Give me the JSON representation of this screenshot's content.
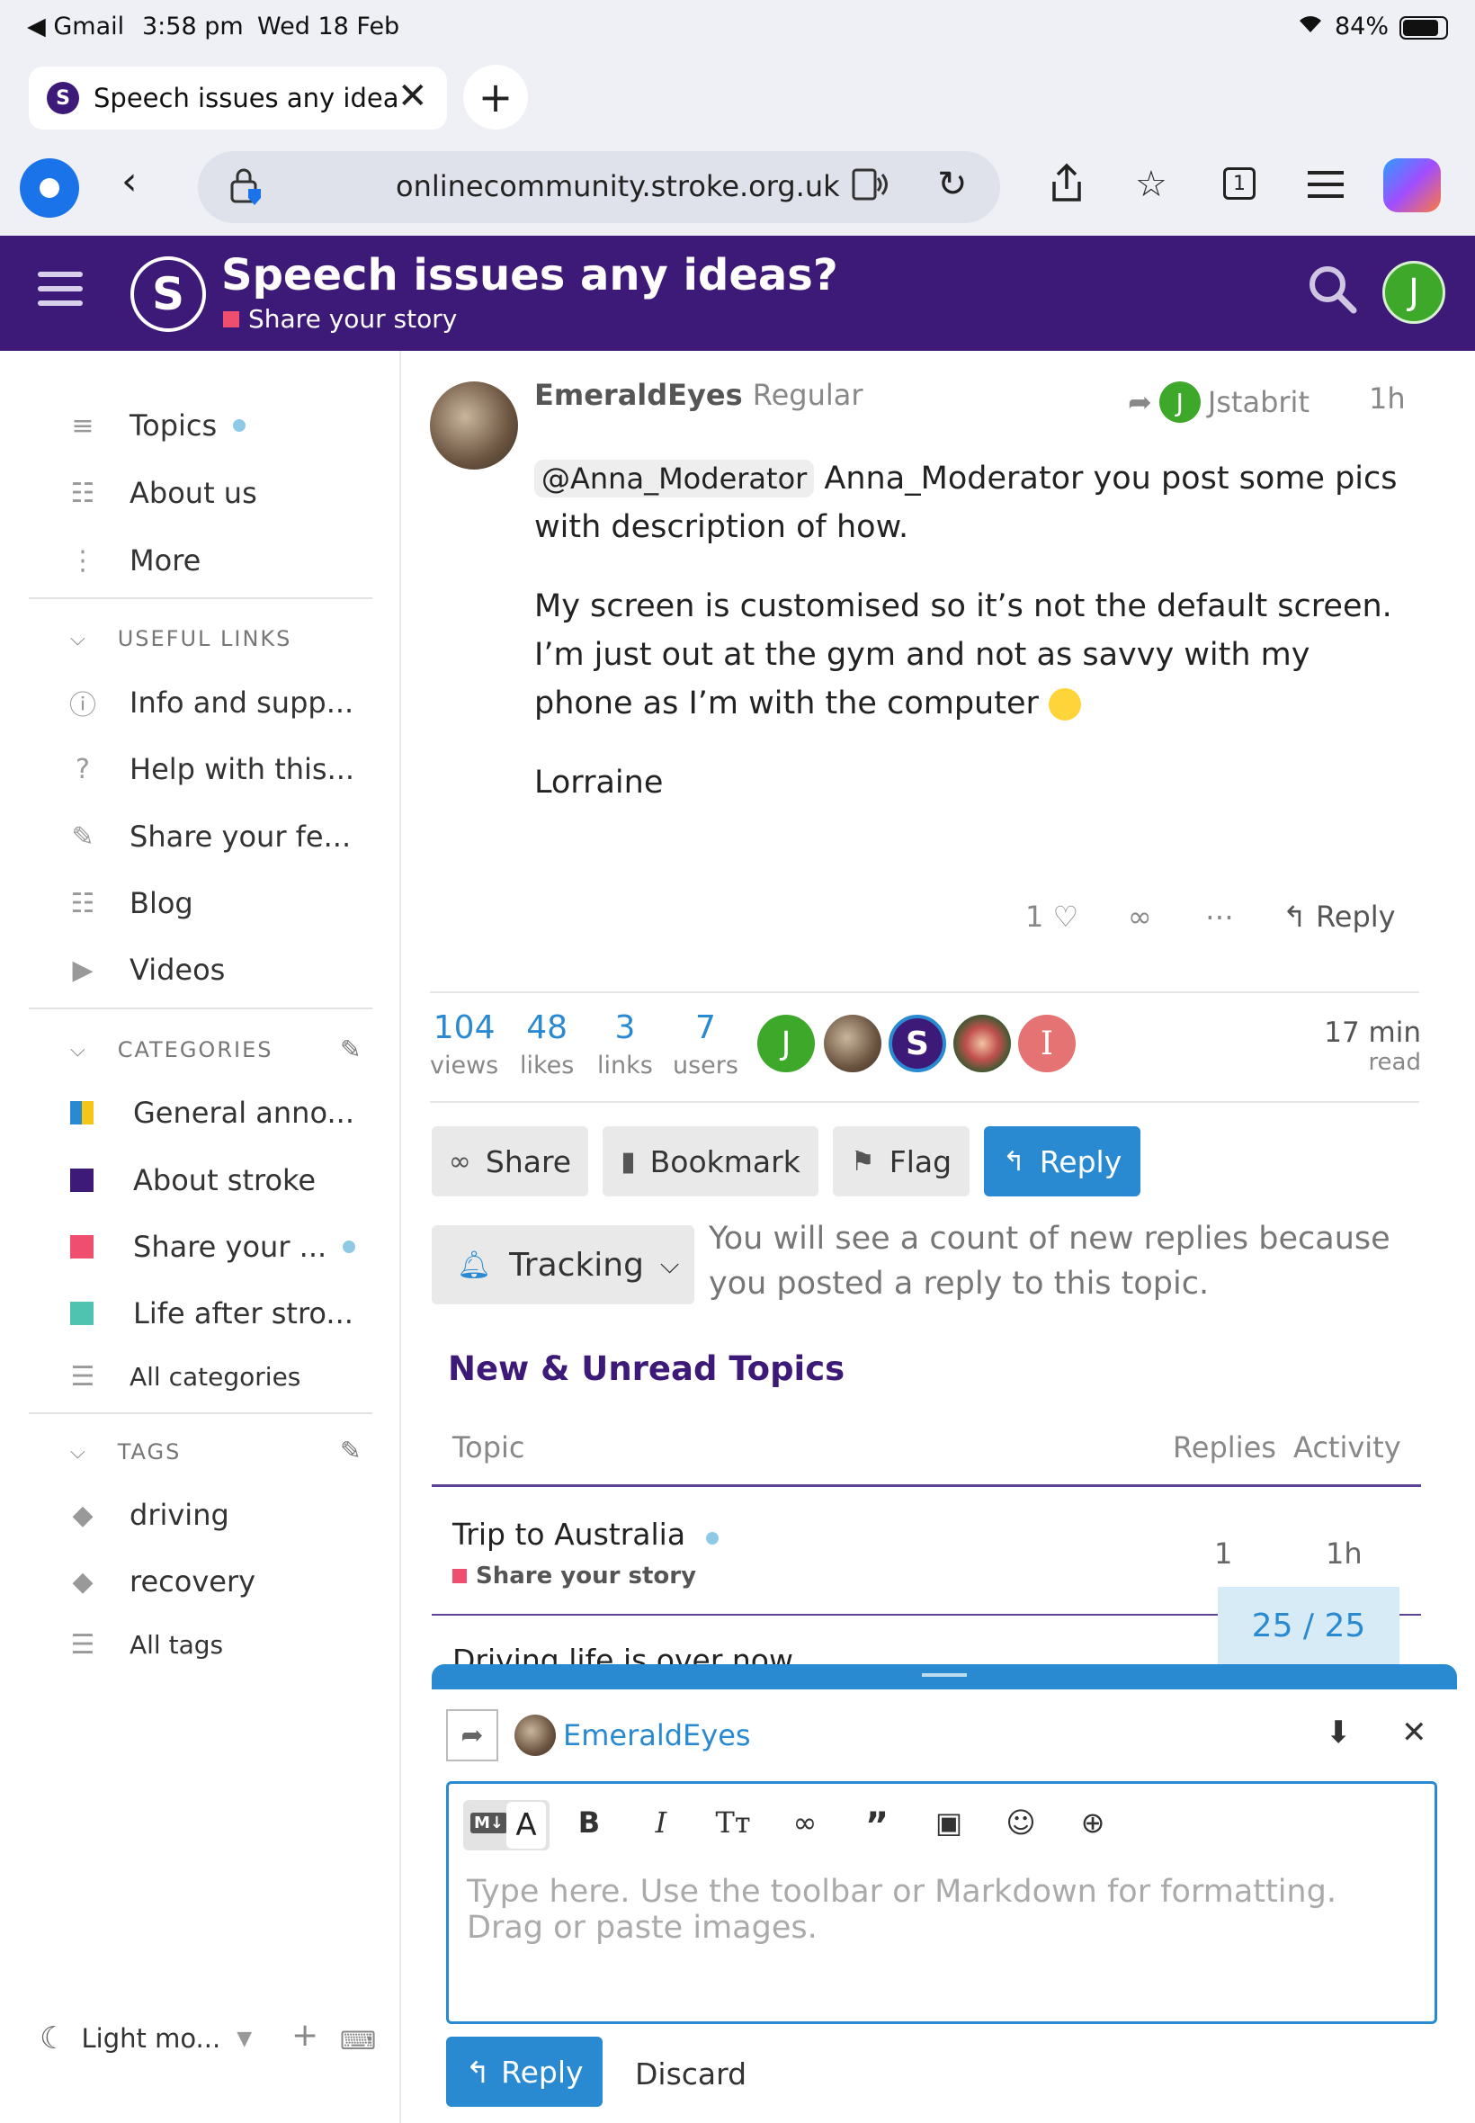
{
  "status_bar": {
    "back_app": "Gmail",
    "time": "3:58 pm",
    "date": "Wed 18 Feb",
    "battery": "84%"
  },
  "browser": {
    "tab_title": "Speech issues any ideas?",
    "tab_favicon_letter": "S",
    "url": "onlinecommunity.stroke.org.uk",
    "tab_count": "1",
    "profile_icon": "person-icon"
  },
  "header": {
    "title": "Speech issues any ideas?",
    "category": "Share your story",
    "logo_letter": "S",
    "user_initial": "J"
  },
  "sidebar": {
    "main": [
      {
        "label": "Topics",
        "icon": "layers-icon",
        "unread": true
      },
      {
        "label": "About us",
        "icon": "list-icon"
      },
      {
        "label": "More",
        "icon": "more-icon"
      }
    ],
    "useful_links_heading": "USEFUL LINKS",
    "useful_links": [
      {
        "label": "Info and supp...",
        "icon": "info-icon"
      },
      {
        "label": "Help with this...",
        "icon": "question-icon"
      },
      {
        "label": "Share your fe...",
        "icon": "pencil-icon"
      },
      {
        "label": "Blog",
        "icon": "chat-icon"
      },
      {
        "label": "Videos",
        "icon": "play-icon"
      }
    ],
    "categories_heading": "CATEGORIES",
    "categories": [
      {
        "label": "General anno...",
        "color": "#f5c518",
        "color2": "#2a8ad1"
      },
      {
        "label": "About stroke",
        "color": "#3d1a78"
      },
      {
        "label": "Share your ...",
        "color": "#f04e6e",
        "unread": true
      },
      {
        "label": "Life after stro...",
        "color": "#4fc3b0"
      }
    ],
    "all_categories": "All categories",
    "tags_heading": "TAGS",
    "tags": [
      {
        "label": "driving"
      },
      {
        "label": "recovery"
      }
    ],
    "all_tags": "All tags",
    "theme_toggle": "Light mo..."
  },
  "post": {
    "username": "EmeraldEyes",
    "user_title": "Regular",
    "reply_to_initial": "J",
    "reply_to_user": "Jstabrit",
    "time_ago": "1h",
    "mention": "@Anna_Moderator",
    "para1": " Anna_Moderator you post some pics with description of how.",
    "para2": "My screen is customised so it’s not the default screen. I’m just out at the gym and not as savvy with my phone as I’m with the computer",
    "signature": "Lorraine",
    "like_count": "1",
    "reply_label": "Reply"
  },
  "topic_map": {
    "views": "104",
    "views_label": "views",
    "likes": "48",
    "likes_label": "likes",
    "links": "3",
    "links_label": "links",
    "users": "7",
    "users_label": "users",
    "read_time": "17 min",
    "read_label": "read",
    "participants": [
      {
        "initial": "J",
        "color": "#3ea82a"
      },
      {
        "initial": "",
        "color": "#6b5440"
      },
      {
        "initial": "S",
        "color": "#3d1a78"
      },
      {
        "initial": "",
        "color": "#8a5a3a"
      },
      {
        "initial": "I",
        "color": "#e57373"
      }
    ]
  },
  "footer_buttons": {
    "share": "Share",
    "bookmark": "Bookmark",
    "flag": "Flag",
    "reply": "Reply"
  },
  "notifications": {
    "level": "Tracking",
    "description": "You will see a count of new replies because you posted a reply to this topic."
  },
  "suggested": {
    "title": "New & Unread Topics",
    "col_topic": "Topic",
    "col_replies": "Replies",
    "col_activity": "Activity",
    "topics": [
      {
        "title": "Trip to Australia",
        "category": "Share your story",
        "replies": "1",
        "activity": "1h"
      },
      {
        "title": "Driving life is over now"
      }
    ],
    "progress": "25 / 25"
  },
  "composer": {
    "reply_to_user": "EmeraldEyes",
    "placeholder": "Type here. Use the toolbar or Markdown for formatting. Drag or paste images.",
    "reply_button": "Reply",
    "discard_button": "Discard",
    "md_toggle": "M↓"
  },
  "colors": {
    "brand": "#3d1a78",
    "accent": "#2a8ad1",
    "share_category": "#f04e6e"
  }
}
